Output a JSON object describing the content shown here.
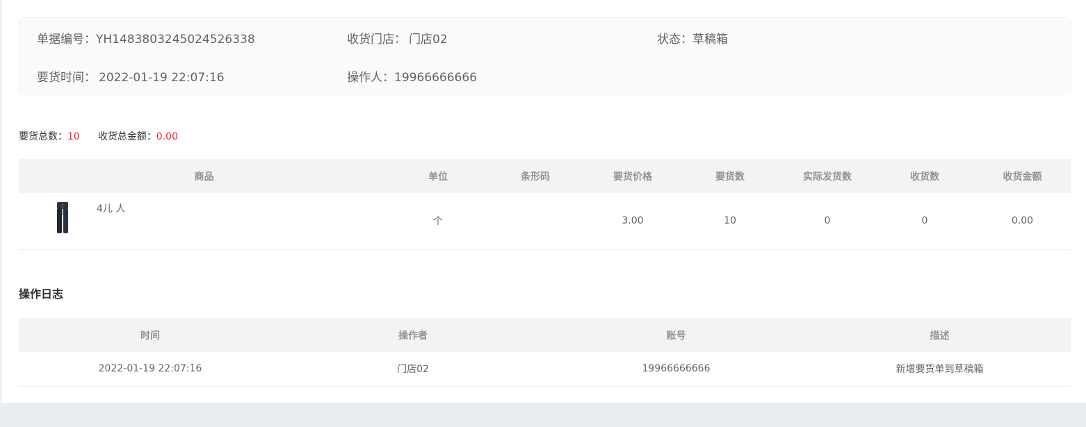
{
  "order": {
    "number_label": "单据编号：",
    "number": "YH1483803245024526338",
    "store_label": "收货门店：",
    "store": "门店02",
    "status_label": "状态：",
    "status": "草稿箱",
    "time_label": "要货时间：",
    "time": "2022-01-19 22:07:16",
    "operator_label": "操作人：",
    "operator": "19966666666"
  },
  "summary": {
    "total_qty_label": "要货总数：",
    "total_qty": "10",
    "total_amount_label": "收货总金额：",
    "total_amount": "0.00"
  },
  "goods_table": {
    "headers": [
      "商品",
      "单位",
      "条形码",
      "要货价格",
      "要货数",
      "实际发货数",
      "收货数",
      "收货金额"
    ],
    "rows": [
      {
        "name": "4儿 人",
        "unit": "个",
        "barcode": "",
        "price": "3.00",
        "qty": "10",
        "shipped": "0",
        "received": "0",
        "amount": "0.00"
      }
    ]
  },
  "log": {
    "title": "操作日志",
    "headers": [
      "时间",
      "操作者",
      "账号",
      "描述"
    ],
    "rows": [
      {
        "time": "2022-01-19 22:07:16",
        "operator": "门店02",
        "account": "19966666666",
        "description": "新增要货单到草稿箱"
      }
    ]
  },
  "colors": {
    "accent_red": "#f5222d",
    "header_bg": "#f3f3f3",
    "page_bg": "#e8edf1"
  },
  "icons": {
    "product_image": "product-thumbnail-icon"
  }
}
